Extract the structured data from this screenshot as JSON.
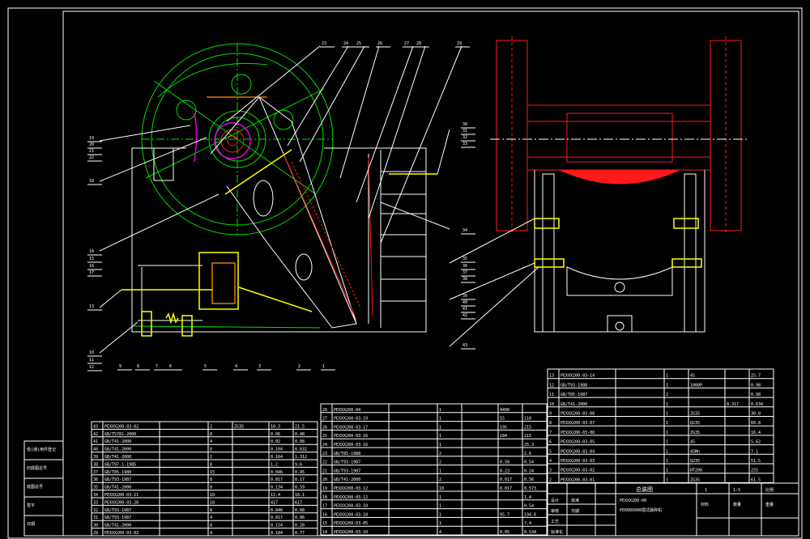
{
  "drawing": {
    "balloons_top": [
      "23",
      "24",
      "25",
      "26",
      "27",
      "28",
      "29"
    ],
    "balloons_left": [
      "19",
      "20",
      "21",
      "22",
      "18",
      "14",
      "15",
      "16",
      "17",
      "13",
      "10",
      "11",
      "12"
    ],
    "balloons_bottom": [
      "9",
      "8",
      "7",
      "6",
      "5",
      "4",
      "3",
      "2",
      "1"
    ],
    "balloons_right": [
      "30",
      "31",
      "32",
      "33",
      "34",
      "35",
      "36",
      "37",
      "38",
      "39",
      "40",
      "41",
      "42",
      "43"
    ]
  },
  "bom_left": {
    "rows": [
      [
        "43",
        "PEXXX200-03-02",
        "",
        "2",
        "ZG35",
        "10.3",
        "21.5"
      ],
      [
        "42",
        "GB/T5781-2000",
        "",
        "8",
        "",
        "0.06",
        "0.48"
      ],
      [
        "41",
        "GB/T41-2000",
        "",
        "4",
        "",
        "0.02",
        "0.08"
      ],
      [
        "40",
        "GB/T41-2000",
        "",
        "8",
        "",
        "0.104",
        "0.832"
      ],
      [
        "39",
        "GB/T41-2000",
        "",
        "1",
        "",
        "0.164",
        "1.312"
      ],
      [
        "38",
        "GB/T97.1-1985",
        "",
        "8",
        "",
        "1.2",
        "9.6"
      ],
      [
        "37",
        "GB/T85-1988",
        "",
        "15",
        "",
        "0.046",
        "0.45"
      ],
      [
        "36",
        "GB/T93-1987",
        "",
        "8",
        "",
        "0.017",
        "0.17"
      ],
      [
        "35",
        "GB/T41-2000",
        "",
        "8",
        "",
        "0.134",
        "0.59"
      ],
      [
        "34",
        "PEXXX200-03-21",
        "",
        "10",
        "",
        "13.4",
        "16.1"
      ],
      [
        "33",
        "PEXXX200-03-20",
        "",
        "10",
        "",
        "417",
        "617"
      ],
      [
        "32",
        "GB/T93-1987",
        "",
        "8",
        "",
        "0.046",
        "0.08"
      ],
      [
        "31",
        "GB/T93-1987",
        "",
        "4",
        "",
        "0.017",
        "0.06"
      ],
      [
        "30",
        "GB/T41-2000",
        "",
        "8",
        "",
        "0.154",
        "0.28"
      ],
      [
        "29",
        "PEXXX200-03-02",
        "",
        "4",
        "",
        "0.184",
        "0.77"
      ]
    ]
  },
  "bom_mid": {
    "rows": [
      [
        "28",
        "PEXXX200-04",
        "",
        "1",
        "",
        "4490",
        ""
      ],
      [
        "27",
        "PEXXX200-03-19",
        "",
        "1",
        "",
        "55",
        "110"
      ],
      [
        "26",
        "PEXXX200-03-17",
        "",
        "1",
        "",
        "195",
        "215"
      ],
      [
        "25",
        "PEXXX200-03-16",
        "",
        "1",
        "",
        "184",
        "215"
      ],
      [
        "24",
        "PEXXX200-03-16",
        "",
        "1",
        "",
        "",
        "25.3"
      ],
      [
        "23",
        "GB/T85-1988",
        "",
        "2",
        "",
        "",
        "2.6"
      ],
      [
        "22",
        "GB/T93-1987",
        "",
        "2",
        "",
        "0.58",
        "0.54"
      ],
      [
        "21",
        "GB/T93-1987",
        "",
        "1",
        "",
        "0.23",
        "0.24"
      ],
      [
        "20",
        "GB/T41-2000",
        "",
        "2",
        "",
        "0.017",
        "0.56"
      ],
      [
        "19",
        "PEXXX200-03-12",
        "",
        "18",
        "",
        "0.017",
        "0.573"
      ],
      [
        "18",
        "PEXXX200-03-12",
        "",
        "1",
        "",
        "",
        "1.4"
      ],
      [
        "17",
        "PEXXX200-03-10",
        "",
        "1",
        "",
        "",
        "0.54"
      ],
      [
        "16",
        "PEXXX200-03-10",
        "",
        "1",
        "",
        "95.7",
        "194.6"
      ],
      [
        "15",
        "PEXXX200-03-05",
        "",
        "1",
        "",
        "",
        "7.4"
      ],
      [
        "14",
        "PEXXX200-03-10",
        "",
        "4",
        "",
        "0.05",
        "0.534"
      ]
    ]
  },
  "bom_right": {
    "rows": [
      [
        "13",
        "PEXXX200-03-14",
        "",
        "1",
        "45",
        "",
        "25.7"
      ],
      [
        "12",
        "GB/T93-1988",
        "",
        "1",
        "1000P",
        "",
        "0.98"
      ],
      [
        "11",
        "GB/T85-1987",
        "",
        "2",
        "",
        "",
        "0.98"
      ],
      [
        "10",
        "GB/T41-2000",
        "",
        "1",
        "",
        "0.317",
        "0.634"
      ],
      [
        "9",
        "PEXXX200-03-08",
        "",
        "1",
        "ZG35",
        "",
        "30.0"
      ],
      [
        "8",
        "PEXXX200-03-07",
        "",
        "1",
        "Q235",
        "",
        "60.8"
      ],
      [
        "7",
        "PEXXX200-03-06",
        "",
        "1",
        "ZG35",
        "",
        "16.4"
      ],
      [
        "6",
        "PEXXX200-03-05",
        "",
        "1",
        "45",
        "",
        "5.62"
      ],
      [
        "5",
        "PEXXX200-03-04",
        "",
        "1",
        "45Mn",
        "",
        "7.1"
      ],
      [
        "4",
        "PEXXX200-03-03",
        "",
        "1",
        "Q235",
        "",
        "51.5"
      ],
      [
        "3",
        "PEXXX200-03-02",
        "",
        "1",
        "HT200",
        "",
        "255"
      ],
      [
        "2",
        "PEXXX200-03-01",
        "",
        "1",
        "ZG35",
        "",
        "61.5"
      ]
    ]
  },
  "title_block": {
    "drawing_title": "总装图",
    "drawing_no": "PEXXX200-00",
    "product": "PE600X900颚式破碎机",
    "scale": "1:5",
    "sheet": "1",
    "labels": [
      "设计",
      "审核",
      "工艺",
      "标准化",
      "批准",
      "日期",
      "材料",
      "数量",
      "重量",
      "比例"
    ],
    "header_right": [
      "序号",
      "代号",
      "名称",
      "数量",
      "材料",
      "单重",
      "总重",
      "备注"
    ]
  },
  "side_labels": [
    "借(通)用件登记",
    "旧底图总号",
    "底图总号",
    "签字",
    "日期"
  ]
}
